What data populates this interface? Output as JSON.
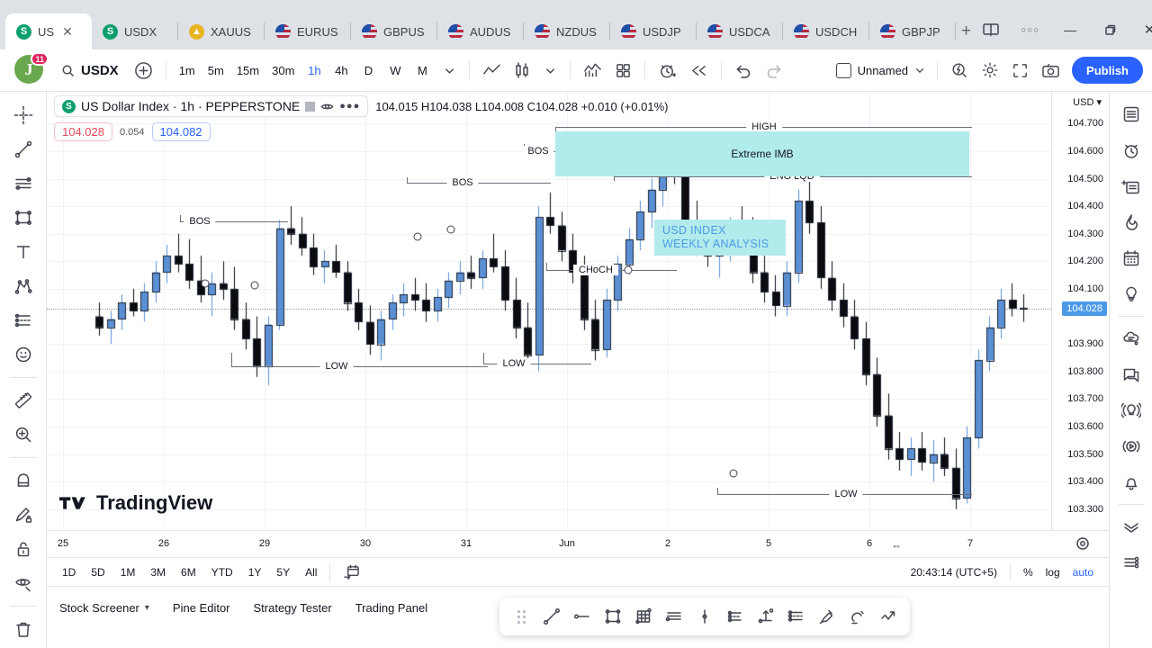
{
  "browser": {
    "tabs": [
      {
        "label": "US",
        "icon": "usd-coin-icon",
        "active": true,
        "closable": true
      },
      {
        "label": "USDX",
        "icon": "usd-coin-icon",
        "active": false
      },
      {
        "label": "XAUUS",
        "icon": "gold-icon",
        "active": false
      },
      {
        "label": "EURUS",
        "icon": "flag-icon",
        "active": false
      },
      {
        "label": "GBPUS",
        "icon": "flag-icon",
        "active": false
      },
      {
        "label": "AUDUS",
        "icon": "flag-icon",
        "active": false
      },
      {
        "label": "NZDUS",
        "icon": "flag-icon",
        "active": false
      },
      {
        "label": "USDJP",
        "icon": "flag-icon",
        "active": false
      },
      {
        "label": "USDCA",
        "icon": "flag-icon",
        "active": false
      },
      {
        "label": "USDCH",
        "icon": "flag-icon",
        "active": false
      },
      {
        "label": "GBPJP",
        "icon": "flag-icon",
        "active": false
      }
    ],
    "new_tab_label": "+",
    "window_controls": {
      "minimize": "—",
      "maximize": "❐",
      "close": "✕",
      "more": "○○○"
    }
  },
  "toolbar": {
    "avatar_initial": "J",
    "notification_count": "11",
    "symbol": "USDX",
    "add_symbol_label": "+",
    "intervals": [
      "1m",
      "5m",
      "15m",
      "30m",
      "1h",
      "4h",
      "D",
      "W",
      "M"
    ],
    "active_interval": "1h",
    "layout_name": "Unnamed",
    "publish_label": "Publish"
  },
  "chart": {
    "symbol_title": "US Dollar Index · 1h · PEPPERSTONE",
    "symbol_badge": "S",
    "ohlc": "104.015  H104.038  L104.008  C104.028  +0.010 (+0.01%)",
    "ohlc_open": "104.015",
    "ohlc_high": "H104.038",
    "ohlc_low": "L104.008",
    "ohlc_close": "C104.028",
    "ohlc_change": "+0.010 (+0.01%)",
    "bid": "104.028",
    "spread": "0.054",
    "ask": "104.082",
    "watermark": "TradingView",
    "price_unit": "USD",
    "last_price": "104.028",
    "annotations": [
      {
        "text": "HIGH"
      },
      {
        "text": "Extreme IMB"
      },
      {
        "text": "ENG LQD"
      },
      {
        "text": "BOS"
      },
      {
        "text": "BOS"
      },
      {
        "text": "BOS"
      },
      {
        "text": "CHoCH"
      },
      {
        "text": "LOW"
      },
      {
        "text": "LOW"
      },
      {
        "text": "LOW"
      }
    ],
    "note": {
      "line1": "USD INDEX",
      "line2": "WEEKLY ANALYSIS"
    }
  },
  "chart_data": {
    "type": "candlestick",
    "title": "US Dollar Index · 1h · PEPPERSTONE",
    "xlabel": "",
    "ylabel": "USD",
    "ylim": [
      103.25,
      104.75
    ],
    "yticks": [
      "104.700",
      "104.600",
      "104.500",
      "104.400",
      "104.300",
      "104.200",
      "104.100",
      "104.028",
      "103.900",
      "103.800",
      "103.700",
      "103.600",
      "103.500",
      "103.400",
      "103.300"
    ],
    "xticks": [
      "25",
      "26",
      "29",
      "30",
      "31",
      "Jun",
      "2",
      "5",
      "6",
      "7"
    ],
    "grid": true,
    "up_color": "#5b8fd4",
    "down_color": "#0b0b10",
    "last_price": 104.028,
    "candles": [
      [
        104.0,
        104.05,
        103.93,
        103.96
      ],
      [
        103.96,
        104.02,
        103.9,
        103.99
      ],
      [
        103.99,
        104.08,
        103.95,
        104.05
      ],
      [
        104.05,
        104.1,
        104.0,
        104.02
      ],
      [
        104.02,
        104.12,
        103.98,
        104.09
      ],
      [
        104.09,
        104.2,
        104.05,
        104.16
      ],
      [
        104.16,
        104.26,
        104.12,
        104.22
      ],
      [
        104.22,
        104.3,
        104.16,
        104.19
      ],
      [
        104.19,
        104.28,
        104.1,
        104.13
      ],
      [
        104.13,
        104.22,
        104.05,
        104.08
      ],
      [
        104.08,
        104.16,
        104.0,
        104.12
      ],
      [
        104.12,
        104.2,
        104.06,
        104.1
      ],
      [
        104.1,
        104.18,
        103.95,
        103.99
      ],
      [
        103.99,
        104.05,
        103.88,
        103.92
      ],
      [
        103.92,
        104.0,
        103.78,
        103.82
      ],
      [
        103.82,
        104.0,
        103.75,
        103.97
      ],
      [
        103.97,
        104.35,
        103.95,
        104.32
      ],
      [
        104.32,
        104.4,
        104.26,
        104.3
      ],
      [
        104.3,
        104.36,
        104.22,
        104.25
      ],
      [
        104.25,
        104.3,
        104.15,
        104.18
      ],
      [
        104.18,
        104.24,
        104.12,
        104.2
      ],
      [
        104.2,
        104.26,
        104.14,
        104.16
      ],
      [
        104.16,
        104.2,
        104.02,
        104.05
      ],
      [
        104.05,
        104.1,
        103.95,
        103.98
      ],
      [
        103.98,
        104.04,
        103.86,
        103.9
      ],
      [
        103.9,
        104.02,
        103.84,
        103.99
      ],
      [
        103.99,
        104.08,
        103.95,
        104.05
      ],
      [
        104.05,
        104.12,
        104.0,
        104.08
      ],
      [
        104.08,
        104.14,
        104.02,
        104.06
      ],
      [
        104.06,
        104.12,
        103.98,
        104.02
      ],
      [
        104.02,
        104.1,
        103.98,
        104.07
      ],
      [
        104.07,
        104.16,
        104.03,
        104.13
      ],
      [
        104.13,
        104.2,
        104.08,
        104.16
      ],
      [
        104.16,
        104.22,
        104.1,
        104.14
      ],
      [
        104.14,
        104.24,
        104.1,
        104.21
      ],
      [
        104.21,
        104.3,
        104.16,
        104.18
      ],
      [
        104.18,
        104.24,
        104.02,
        104.06
      ],
      [
        104.06,
        104.14,
        103.92,
        103.96
      ],
      [
        103.96,
        104.05,
        103.82,
        103.86
      ],
      [
        103.86,
        104.4,
        103.8,
        104.36
      ],
      [
        104.36,
        104.45,
        104.3,
        104.33
      ],
      [
        104.33,
        104.38,
        104.2,
        104.24
      ],
      [
        104.24,
        104.3,
        104.12,
        104.16
      ],
      [
        104.16,
        104.22,
        103.95,
        103.99
      ],
      [
        103.99,
        104.06,
        103.84,
        103.88
      ],
      [
        103.88,
        104.1,
        103.85,
        104.06
      ],
      [
        104.06,
        104.22,
        104.02,
        104.19
      ],
      [
        104.19,
        104.32,
        104.15,
        104.28
      ],
      [
        104.28,
        104.42,
        104.24,
        104.38
      ],
      [
        104.38,
        104.5,
        104.32,
        104.46
      ],
      [
        104.46,
        104.6,
        104.4,
        104.56
      ],
      [
        104.56,
        104.66,
        104.48,
        104.52
      ],
      [
        104.52,
        104.58,
        104.3,
        104.34
      ],
      [
        104.34,
        104.42,
        104.22,
        104.26
      ],
      [
        104.26,
        104.33,
        104.18,
        104.22
      ],
      [
        104.22,
        104.3,
        104.14,
        104.26
      ],
      [
        104.26,
        104.36,
        104.2,
        104.32
      ],
      [
        104.32,
        104.4,
        104.26,
        104.3
      ],
      [
        104.3,
        104.36,
        104.12,
        104.16
      ],
      [
        104.16,
        104.22,
        104.05,
        104.09
      ],
      [
        104.09,
        104.15,
        104.0,
        104.04
      ],
      [
        104.04,
        104.2,
        104.0,
        104.16
      ],
      [
        104.16,
        104.46,
        104.12,
        104.42
      ],
      [
        104.42,
        104.5,
        104.3,
        104.34
      ],
      [
        104.34,
        104.4,
        104.1,
        104.14
      ],
      [
        104.14,
        104.2,
        104.02,
        104.06
      ],
      [
        104.06,
        104.12,
        103.96,
        104.0
      ],
      [
        104.0,
        104.06,
        103.88,
        103.92
      ],
      [
        103.92,
        103.98,
        103.75,
        103.79
      ],
      [
        103.79,
        103.85,
        103.6,
        103.64
      ],
      [
        103.64,
        103.72,
        103.48,
        103.52
      ],
      [
        103.52,
        103.58,
        103.44,
        103.48
      ],
      [
        103.48,
        103.56,
        103.42,
        103.52
      ],
      [
        103.52,
        103.58,
        103.44,
        103.47
      ],
      [
        103.47,
        103.55,
        103.4,
        103.5
      ],
      [
        103.5,
        103.56,
        103.42,
        103.45
      ],
      [
        103.45,
        103.52,
        103.3,
        103.34
      ],
      [
        103.34,
        103.6,
        103.32,
        103.56
      ],
      [
        103.56,
        103.88,
        103.52,
        103.84
      ],
      [
        103.84,
        104.0,
        103.8,
        103.96
      ],
      [
        103.96,
        104.1,
        103.92,
        104.06
      ],
      [
        104.06,
        104.12,
        104.0,
        104.03
      ],
      [
        104.03,
        104.08,
        103.98,
        104.028
      ]
    ]
  },
  "leftbar": {
    "tools": [
      {
        "name": "cross-cursor-icon"
      },
      {
        "name": "trend-line-icon"
      },
      {
        "name": "horizontal-lines-icon"
      },
      {
        "name": "rectangle-icon"
      },
      {
        "name": "text-icon"
      },
      {
        "name": "pitchfork-icon"
      },
      {
        "name": "fib-retracement-icon"
      },
      {
        "name": "emoji-icon"
      },
      {
        "name": "ruler-icon"
      },
      {
        "name": "zoom-in-icon"
      },
      {
        "name": "magnet-icon"
      },
      {
        "name": "pencil-lock-icon"
      },
      {
        "name": "lock-icon"
      },
      {
        "name": "eye-hide-icon"
      },
      {
        "name": "trash-icon"
      }
    ]
  },
  "rightbar": {
    "tools": [
      {
        "name": "watchlist-icon"
      },
      {
        "name": "alerts-icon"
      },
      {
        "name": "data-window-icon"
      },
      {
        "name": "hotlist-icon"
      },
      {
        "name": "calendar-icon"
      },
      {
        "name": "ideas-icon"
      },
      {
        "name": "chat-cloud-icon"
      },
      {
        "name": "public-chat-icon"
      },
      {
        "name": "broadcast-icon"
      },
      {
        "name": "stream-icon"
      },
      {
        "name": "notifications-icon"
      },
      {
        "name": "collapse-icon"
      },
      {
        "name": "settings-list-icon"
      }
    ]
  },
  "statusbar": {
    "ranges": [
      "1D",
      "5D",
      "1M",
      "3M",
      "6M",
      "YTD",
      "1Y",
      "5Y",
      "All"
    ],
    "time": "20:43:14 (UTC+5)",
    "percent_label": "%",
    "log_label": "log",
    "auto_label": "auto"
  },
  "bottompanel": {
    "items": [
      "Stock Screener",
      "Pine Editor",
      "Strategy Tester",
      "Trading Panel"
    ],
    "active": "Stock Screener"
  },
  "floatbar": {
    "tools": [
      {
        "name": "drag-handle-icon"
      },
      {
        "name": "trend-line-icon"
      },
      {
        "name": "ray-icon"
      },
      {
        "name": "rectangle-icon"
      },
      {
        "name": "grid-icon"
      },
      {
        "name": "parallel-channel-icon"
      },
      {
        "name": "vertical-line-icon"
      },
      {
        "name": "flat-bottom-icon"
      },
      {
        "name": "long-position-icon"
      },
      {
        "name": "fib-channel-icon"
      },
      {
        "name": "brush-icon"
      },
      {
        "name": "highlighter-icon"
      },
      {
        "name": "zigzag-arrow-icon"
      }
    ]
  },
  "colors": {
    "accent": "#2962ff",
    "zone": "#b2ebeb",
    "up": "#5b8fd4",
    "down": "#0b0b10",
    "badge": "#4c9ae8"
  }
}
